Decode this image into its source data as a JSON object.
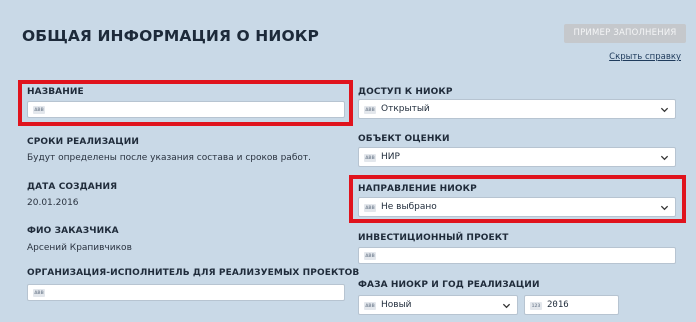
{
  "header": {
    "title": "ОБЩАЯ ИНФОРМАЦИЯ О НИОКР",
    "example_button": "ПРИМЕР ЗАПОЛНЕНИЯ",
    "help_link": "Скрыть справку"
  },
  "left": {
    "name_label": "НАЗВАНИЕ",
    "name_value": "",
    "terms_label": "СРОКИ РЕАЛИЗАЦИИ",
    "terms_text": "Будут определены после указания состава и сроков работ.",
    "created_label": "ДАТА СОЗДАНИЯ",
    "created_value": "20.01.2016",
    "customer_label": "ФИО ЗАКАЗЧИКА",
    "customer_value": "Арсений Крапивчиков",
    "org_label": "ОРГАНИЗАЦИЯ-ИСПОЛНИТЕЛЬ ДЛЯ РЕАЛИЗУЕМЫХ ПРОЕКТОВ",
    "org_value": ""
  },
  "right": {
    "access_label": "ДОСТУП К НИОКР",
    "access_value": "Открытый",
    "object_label": "ОБЪЕКТ ОЦЕНКИ",
    "object_value": "НИР",
    "direction_label": "НАПРАВЛЕНИЕ НИОКР",
    "direction_value": "Не выбрано",
    "invest_label": "ИНВЕСТИЦИОННЫЙ ПРОЕКТ",
    "invest_value": "",
    "phase_label": "ФАЗА НИОКР И ГОД РЕАЛИЗАЦИИ",
    "phase_value": "Новый",
    "year_value": "2016"
  },
  "badges": {
    "text": "ABB",
    "number": "123"
  },
  "colors": {
    "panel": "#c9d9e7",
    "highlight": "#e0131d",
    "button": "#c5c8cc"
  },
  "icons": {
    "text_type": "abc-text-icon",
    "number_type": "123-number-icon",
    "dropdown": "chevron-down-icon"
  }
}
